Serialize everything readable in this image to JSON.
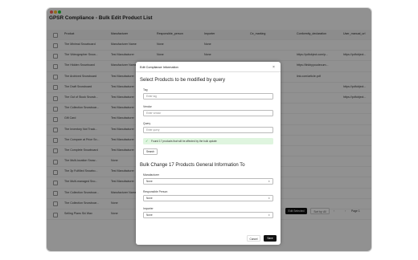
{
  "app": {
    "title": "GPSR Compliance - Bulk Edit Product List"
  },
  "table": {
    "headers": [
      "Product",
      "Manufacturer",
      "Responsible_person",
      "Importer",
      "Ce_marking",
      "Conformity_declaration",
      "User_manual_url"
    ],
    "rows": [
      [
        "The Minimal Snowboard",
        "Manufacturer Name",
        "None",
        "None",
        "",
        "",
        ""
      ],
      [
        "The Videographer Snow...",
        "Test Manufacturer",
        "None",
        "None",
        "",
        "https://pdfobject.com/p...",
        "https://pdfobject..."
      ],
      [
        "The Hidden Snowboard",
        "Manufacturer Name",
        "",
        "",
        "",
        "https://linkbyyoudecum...",
        ""
      ],
      [
        "The Archived Snowboard",
        "Test Manufacturer",
        "",
        "",
        "",
        "link.com/article.pdf",
        ""
      ],
      [
        "The Draft Snowboard",
        "Test Manufacturer",
        "",
        "",
        "",
        "",
        "https://pdfobject..."
      ],
      [
        "The Out of Stock Snowb...",
        "Test Manufacturer",
        "",
        "",
        "",
        "",
        "https://pdfobject..."
      ],
      [
        "The Collection Snowboar...",
        "Test Manufacturer",
        "",
        "",
        "",
        "",
        ""
      ],
      [
        "Gift Card",
        "Test Manufacturer",
        "",
        "",
        "",
        "",
        ""
      ],
      [
        "The Inventory Not Track...",
        "Test Manufacturer",
        "",
        "",
        "",
        "",
        ""
      ],
      [
        "The Compare at Price Sn...",
        "Test Manufacturer",
        "",
        "",
        "",
        "",
        ""
      ],
      [
        "The Complete Snowboard",
        "Test Manufacturer",
        "",
        "",
        "",
        "",
        ""
      ],
      [
        "The Multi-location Snow...",
        "None",
        "",
        "",
        "",
        "",
        ""
      ],
      [
        "The 3p Fulfilled Snowbo...",
        "Test Manufacturer",
        "",
        "",
        "",
        "",
        ""
      ],
      [
        "The Multi-managed Sno...",
        "Test Manufacturer",
        "",
        "",
        "",
        "",
        ""
      ],
      [
        "The Collection Snowboar...",
        "Manufacturer Name",
        "",
        "",
        "",
        "",
        ""
      ],
      [
        "The Collection Snowboar...",
        "None",
        "",
        "",
        "",
        "",
        ""
      ],
      [
        "Selling Plans Ski Wax",
        "None",
        "",
        "",
        "",
        "",
        ""
      ]
    ]
  },
  "footer": {
    "edit_selected": "Edit Selected",
    "sort_by": "Sort by: All",
    "prev": "‹",
    "next": "›",
    "page": "Page 1"
  },
  "modal": {
    "title": "Edit Compliance Information",
    "close": "×",
    "section1": "Select Products to be modified by query",
    "tag_label": "Tag",
    "tag_placeholder": "Enter tag",
    "vendor_label": "Vendor",
    "vendor_placeholder": "Enter vendor",
    "query_label": "Query",
    "query_placeholder": "Enter query",
    "success": "Found 17 products that will be affected by the bulk update",
    "search": "Search",
    "section2": "Bulk Change 17 Products General Information To",
    "manufacturer_label": "Manufacturer",
    "manufacturer_value": "None",
    "responsible_label": "Responsible Person",
    "responsible_value": "None",
    "importer_label": "Importer",
    "importer_value": "None",
    "cancel": "Cancel",
    "save": "Save"
  }
}
